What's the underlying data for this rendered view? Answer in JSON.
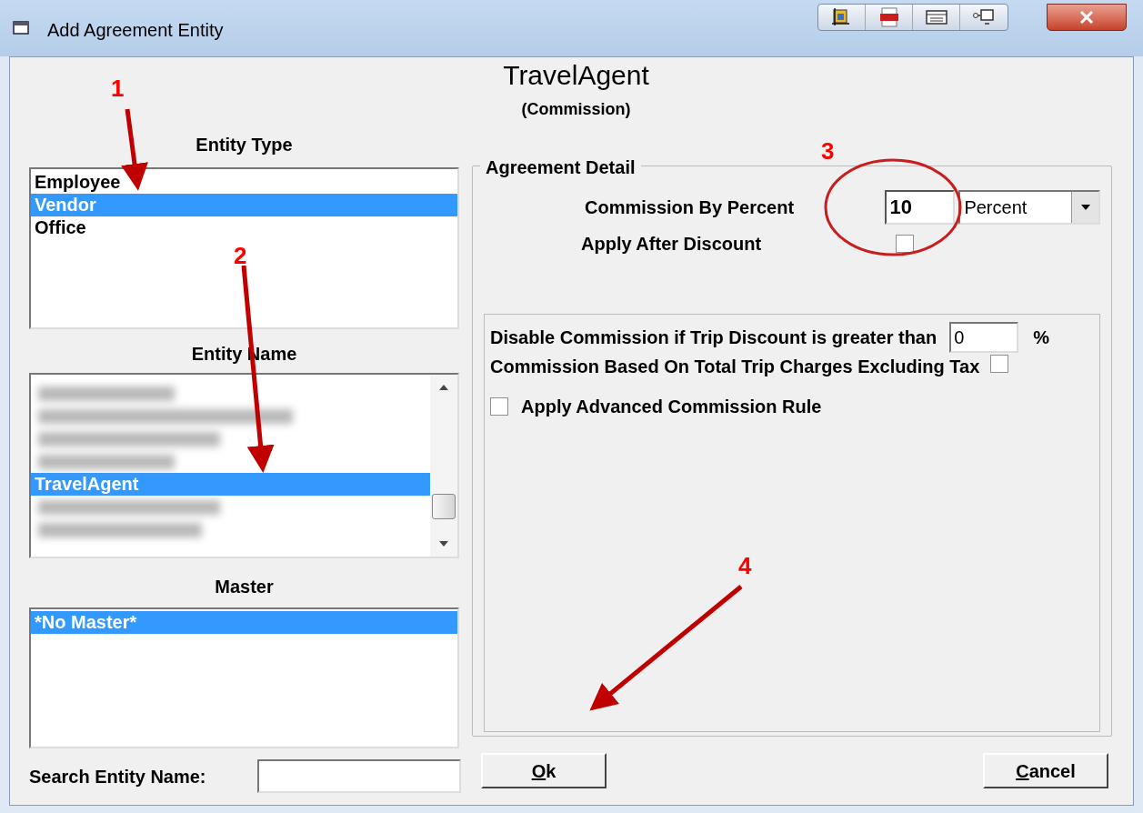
{
  "window": {
    "title": "Add Agreement Entity"
  },
  "header": {
    "title": "TravelAgent",
    "subtitle": "(Commission)"
  },
  "entity_type": {
    "label": "Entity Type",
    "items": [
      {
        "text": "Employee",
        "selected": false
      },
      {
        "text": "Vendor",
        "selected": true
      },
      {
        "text": "Office",
        "selected": false
      }
    ]
  },
  "entity_name": {
    "label": "Entity Name",
    "items": [
      {
        "kind": "redacted",
        "selected": false
      },
      {
        "kind": "redacted",
        "selected": false
      },
      {
        "kind": "redacted",
        "selected": false
      },
      {
        "kind": "redacted",
        "selected": false
      },
      {
        "kind": "text",
        "text": "TravelAgent",
        "selected": true
      },
      {
        "kind": "redacted",
        "selected": false
      },
      {
        "kind": "redacted",
        "selected": false
      }
    ]
  },
  "master": {
    "label": "Master",
    "items": [
      {
        "text": "*No Master*",
        "selected": true
      }
    ]
  },
  "search": {
    "label": "Search Entity Name:"
  },
  "agreement_detail": {
    "legend": "Agreement Detail",
    "commission_by_percent": {
      "label": "Commission By Percent",
      "value": "10",
      "unit": "Percent"
    },
    "apply_after_discount": {
      "label": "Apply After Discount",
      "checked": false
    },
    "disable_commission": {
      "label": "Disable Commission if Trip Discount is greater than",
      "value": "0",
      "suffix": "%"
    },
    "based_on_total": {
      "label": "Commission Based On Total Trip Charges Excluding Tax",
      "checked": false
    },
    "advanced_rule": {
      "label": "Apply Advanced Commission Rule",
      "checked": false
    }
  },
  "buttons": [
    {
      "label": "Ok"
    },
    {
      "label": "Cancel"
    }
  ],
  "annotations": [
    "1",
    "2",
    "3",
    "4"
  ]
}
